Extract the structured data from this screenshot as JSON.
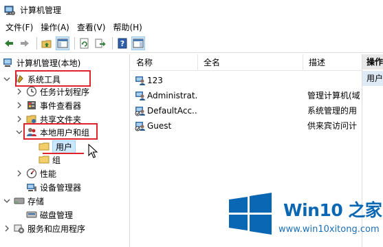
{
  "window": {
    "title": "计算机管理"
  },
  "menu": [
    "文件(F)",
    "操作(A)",
    "查看(V)",
    "帮助(H)"
  ],
  "toolbar": [
    "back-icon",
    "forward-icon",
    "up-folder-icon",
    "show-hide-tree-icon",
    "refresh-icon",
    "export-list-icon",
    "help-icon",
    "properties-icon"
  ],
  "tree": {
    "root": "计算机管理(本地)",
    "system_tools": "系统工具",
    "task_scheduler": "任务计划程序",
    "event_viewer": "事件查看器",
    "shared_folders": "共享文件夹",
    "local_users_groups": "本地用户和组",
    "users": "用户",
    "groups": "组",
    "performance": "性能",
    "device_manager": "设备管理器",
    "storage": "存储",
    "disk_management": "磁盘管理",
    "services_apps": "服务和应用程序"
  },
  "list": {
    "columns": [
      "名称",
      "全名",
      "描述"
    ],
    "rows": [
      {
        "name": "123",
        "fullname": "",
        "description": ""
      },
      {
        "name": "Administrat...",
        "fullname": "",
        "description": "管理计算机(域"
      },
      {
        "name": "DefaultAcc...",
        "fullname": "",
        "description": "系统管理的用"
      },
      {
        "name": "Guest",
        "fullname": "",
        "description": "供来宾访问计"
      }
    ]
  },
  "actions": {
    "header": "操作",
    "item": "用户"
  },
  "watermark": {
    "brand": "Win10 之家",
    "url": "www.win10xitong.com"
  },
  "colors": {
    "highlight": "#e0222a",
    "selection": "#cce8ff",
    "brand_blue": "#0a67b3"
  }
}
